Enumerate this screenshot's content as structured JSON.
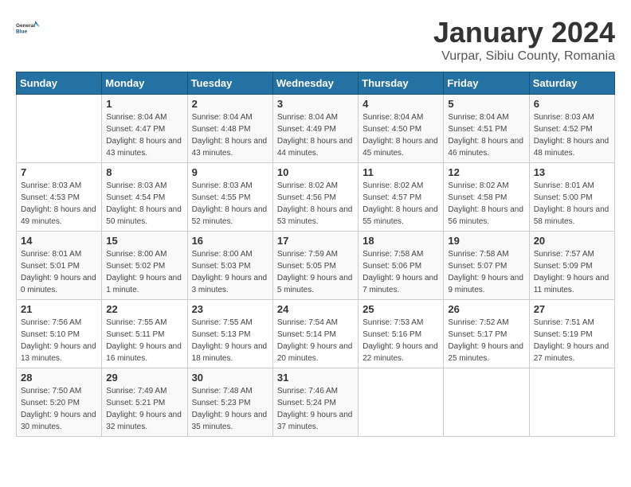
{
  "logo": {
    "general": "General",
    "blue": "Blue"
  },
  "title": "January 2024",
  "subtitle": "Vurpar, Sibiu County, Romania",
  "days_of_week": [
    "Sunday",
    "Monday",
    "Tuesday",
    "Wednesday",
    "Thursday",
    "Friday",
    "Saturday"
  ],
  "weeks": [
    [
      {
        "day": "",
        "sunrise": "",
        "sunset": "",
        "daylight": ""
      },
      {
        "day": "1",
        "sunrise": "Sunrise: 8:04 AM",
        "sunset": "Sunset: 4:47 PM",
        "daylight": "Daylight: 8 hours and 43 minutes."
      },
      {
        "day": "2",
        "sunrise": "Sunrise: 8:04 AM",
        "sunset": "Sunset: 4:48 PM",
        "daylight": "Daylight: 8 hours and 43 minutes."
      },
      {
        "day": "3",
        "sunrise": "Sunrise: 8:04 AM",
        "sunset": "Sunset: 4:49 PM",
        "daylight": "Daylight: 8 hours and 44 minutes."
      },
      {
        "day": "4",
        "sunrise": "Sunrise: 8:04 AM",
        "sunset": "Sunset: 4:50 PM",
        "daylight": "Daylight: 8 hours and 45 minutes."
      },
      {
        "day": "5",
        "sunrise": "Sunrise: 8:04 AM",
        "sunset": "Sunset: 4:51 PM",
        "daylight": "Daylight: 8 hours and 46 minutes."
      },
      {
        "day": "6",
        "sunrise": "Sunrise: 8:03 AM",
        "sunset": "Sunset: 4:52 PM",
        "daylight": "Daylight: 8 hours and 48 minutes."
      }
    ],
    [
      {
        "day": "7",
        "sunrise": "Sunrise: 8:03 AM",
        "sunset": "Sunset: 4:53 PM",
        "daylight": "Daylight: 8 hours and 49 minutes."
      },
      {
        "day": "8",
        "sunrise": "Sunrise: 8:03 AM",
        "sunset": "Sunset: 4:54 PM",
        "daylight": "Daylight: 8 hours and 50 minutes."
      },
      {
        "day": "9",
        "sunrise": "Sunrise: 8:03 AM",
        "sunset": "Sunset: 4:55 PM",
        "daylight": "Daylight: 8 hours and 52 minutes."
      },
      {
        "day": "10",
        "sunrise": "Sunrise: 8:02 AM",
        "sunset": "Sunset: 4:56 PM",
        "daylight": "Daylight: 8 hours and 53 minutes."
      },
      {
        "day": "11",
        "sunrise": "Sunrise: 8:02 AM",
        "sunset": "Sunset: 4:57 PM",
        "daylight": "Daylight: 8 hours and 55 minutes."
      },
      {
        "day": "12",
        "sunrise": "Sunrise: 8:02 AM",
        "sunset": "Sunset: 4:58 PM",
        "daylight": "Daylight: 8 hours and 56 minutes."
      },
      {
        "day": "13",
        "sunrise": "Sunrise: 8:01 AM",
        "sunset": "Sunset: 5:00 PM",
        "daylight": "Daylight: 8 hours and 58 minutes."
      }
    ],
    [
      {
        "day": "14",
        "sunrise": "Sunrise: 8:01 AM",
        "sunset": "Sunset: 5:01 PM",
        "daylight": "Daylight: 9 hours and 0 minutes."
      },
      {
        "day": "15",
        "sunrise": "Sunrise: 8:00 AM",
        "sunset": "Sunset: 5:02 PM",
        "daylight": "Daylight: 9 hours and 1 minute."
      },
      {
        "day": "16",
        "sunrise": "Sunrise: 8:00 AM",
        "sunset": "Sunset: 5:03 PM",
        "daylight": "Daylight: 9 hours and 3 minutes."
      },
      {
        "day": "17",
        "sunrise": "Sunrise: 7:59 AM",
        "sunset": "Sunset: 5:05 PM",
        "daylight": "Daylight: 9 hours and 5 minutes."
      },
      {
        "day": "18",
        "sunrise": "Sunrise: 7:58 AM",
        "sunset": "Sunset: 5:06 PM",
        "daylight": "Daylight: 9 hours and 7 minutes."
      },
      {
        "day": "19",
        "sunrise": "Sunrise: 7:58 AM",
        "sunset": "Sunset: 5:07 PM",
        "daylight": "Daylight: 9 hours and 9 minutes."
      },
      {
        "day": "20",
        "sunrise": "Sunrise: 7:57 AM",
        "sunset": "Sunset: 5:09 PM",
        "daylight": "Daylight: 9 hours and 11 minutes."
      }
    ],
    [
      {
        "day": "21",
        "sunrise": "Sunrise: 7:56 AM",
        "sunset": "Sunset: 5:10 PM",
        "daylight": "Daylight: 9 hours and 13 minutes."
      },
      {
        "day": "22",
        "sunrise": "Sunrise: 7:55 AM",
        "sunset": "Sunset: 5:11 PM",
        "daylight": "Daylight: 9 hours and 16 minutes."
      },
      {
        "day": "23",
        "sunrise": "Sunrise: 7:55 AM",
        "sunset": "Sunset: 5:13 PM",
        "daylight": "Daylight: 9 hours and 18 minutes."
      },
      {
        "day": "24",
        "sunrise": "Sunrise: 7:54 AM",
        "sunset": "Sunset: 5:14 PM",
        "daylight": "Daylight: 9 hours and 20 minutes."
      },
      {
        "day": "25",
        "sunrise": "Sunrise: 7:53 AM",
        "sunset": "Sunset: 5:16 PM",
        "daylight": "Daylight: 9 hours and 22 minutes."
      },
      {
        "day": "26",
        "sunrise": "Sunrise: 7:52 AM",
        "sunset": "Sunset: 5:17 PM",
        "daylight": "Daylight: 9 hours and 25 minutes."
      },
      {
        "day": "27",
        "sunrise": "Sunrise: 7:51 AM",
        "sunset": "Sunset: 5:19 PM",
        "daylight": "Daylight: 9 hours and 27 minutes."
      }
    ],
    [
      {
        "day": "28",
        "sunrise": "Sunrise: 7:50 AM",
        "sunset": "Sunset: 5:20 PM",
        "daylight": "Daylight: 9 hours and 30 minutes."
      },
      {
        "day": "29",
        "sunrise": "Sunrise: 7:49 AM",
        "sunset": "Sunset: 5:21 PM",
        "daylight": "Daylight: 9 hours and 32 minutes."
      },
      {
        "day": "30",
        "sunrise": "Sunrise: 7:48 AM",
        "sunset": "Sunset: 5:23 PM",
        "daylight": "Daylight: 9 hours and 35 minutes."
      },
      {
        "day": "31",
        "sunrise": "Sunrise: 7:46 AM",
        "sunset": "Sunset: 5:24 PM",
        "daylight": "Daylight: 9 hours and 37 minutes."
      },
      {
        "day": "",
        "sunrise": "",
        "sunset": "",
        "daylight": ""
      },
      {
        "day": "",
        "sunrise": "",
        "sunset": "",
        "daylight": ""
      },
      {
        "day": "",
        "sunrise": "",
        "sunset": "",
        "daylight": ""
      }
    ]
  ]
}
